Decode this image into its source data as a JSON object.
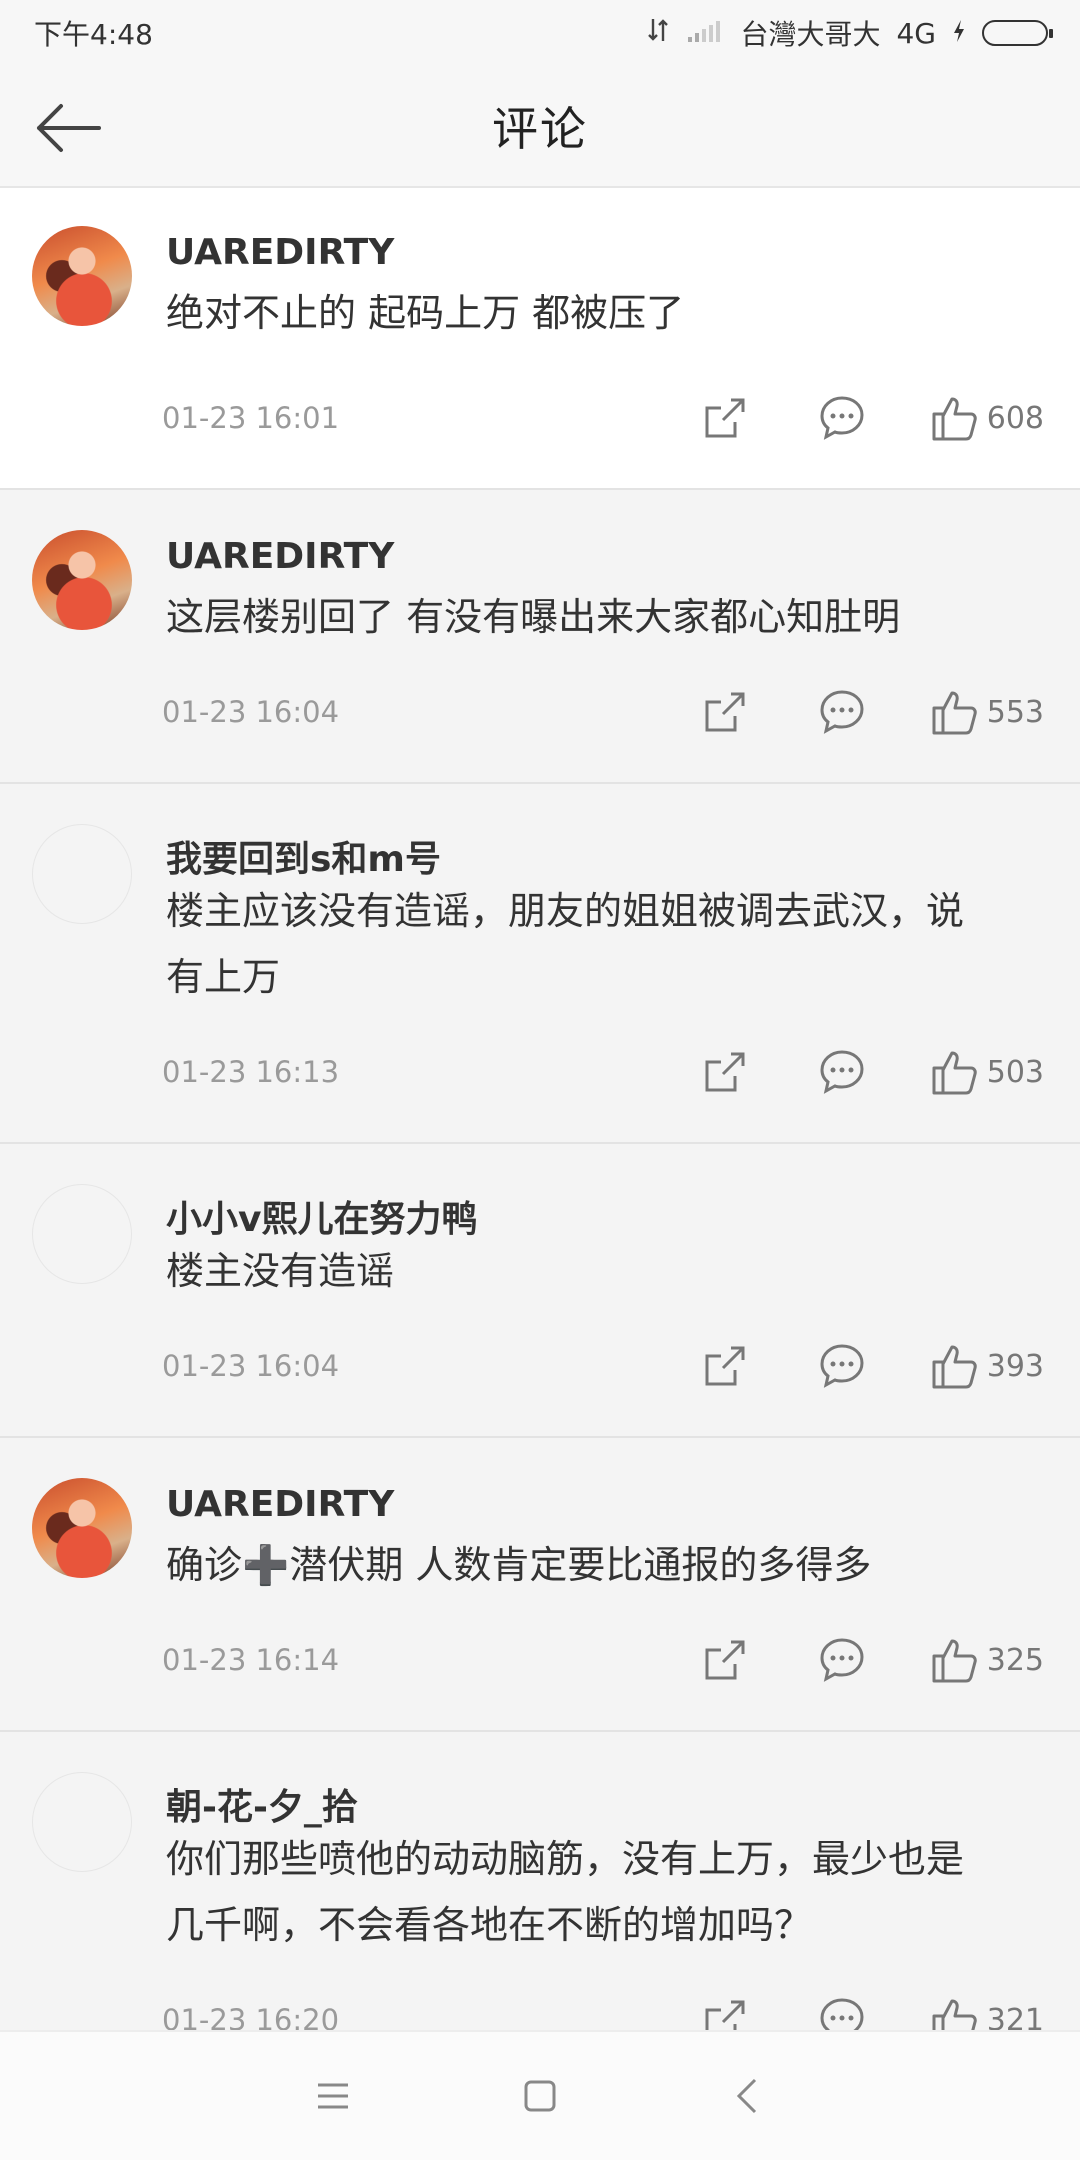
{
  "status_bar": {
    "time": "下午4:48",
    "carrier": "台灣大哥大",
    "network": "4G",
    "signal_icon": "signal-icon",
    "battery_icon": "battery-charging-icon"
  },
  "header": {
    "title": "评论",
    "back_icon": "back-arrow-icon"
  },
  "comments": [
    {
      "username": "UAREDIRTY",
      "text_lines": [
        "绝对不止的 起码上万 都被压了"
      ],
      "timestamp": "01-23 16:01",
      "likes": "608",
      "avatar": "photo"
    },
    {
      "username": "UAREDIRTY",
      "text_lines": [
        "这层楼别回了 有没有曝出来大家都心知肚明"
      ],
      "timestamp": "01-23 16:04",
      "likes": "553",
      "avatar": "photo"
    },
    {
      "username": "我要回到s和m号",
      "text_lines": [
        "楼主应该没有造谣，朋友的姐姐被调去武汉，说",
        "有上万"
      ],
      "timestamp": "01-23 16:13",
      "likes": "503",
      "avatar": "blank"
    },
    {
      "username": "小小v熙儿在努力鸭",
      "text_lines": [
        "楼主没有造谣"
      ],
      "timestamp": "01-23 16:04",
      "likes": "393",
      "avatar": "blank"
    },
    {
      "username": "UAREDIRTY",
      "text_lines": [
        "确诊➕潜伏期 人数肯定要比通报的多得多"
      ],
      "timestamp": "01-23 16:14",
      "likes": "325",
      "avatar": "photo"
    },
    {
      "username": "朝-花-夕_拾",
      "text_lines": [
        "你们那些喷他的动动脑筋，没有上万，最少也是",
        "几千啊，不会看各地在不断的增加吗？"
      ],
      "timestamp": "01-23 16:20",
      "likes": "321",
      "avatar": "blank"
    }
  ],
  "icons": {
    "share": "share-icon",
    "reply": "comment-bubble-icon",
    "like": "thumbs-up-icon"
  },
  "nav": {
    "menu_icon": "menu-icon",
    "home_icon": "home-square-icon",
    "back_icon": "back-chevron-icon"
  }
}
